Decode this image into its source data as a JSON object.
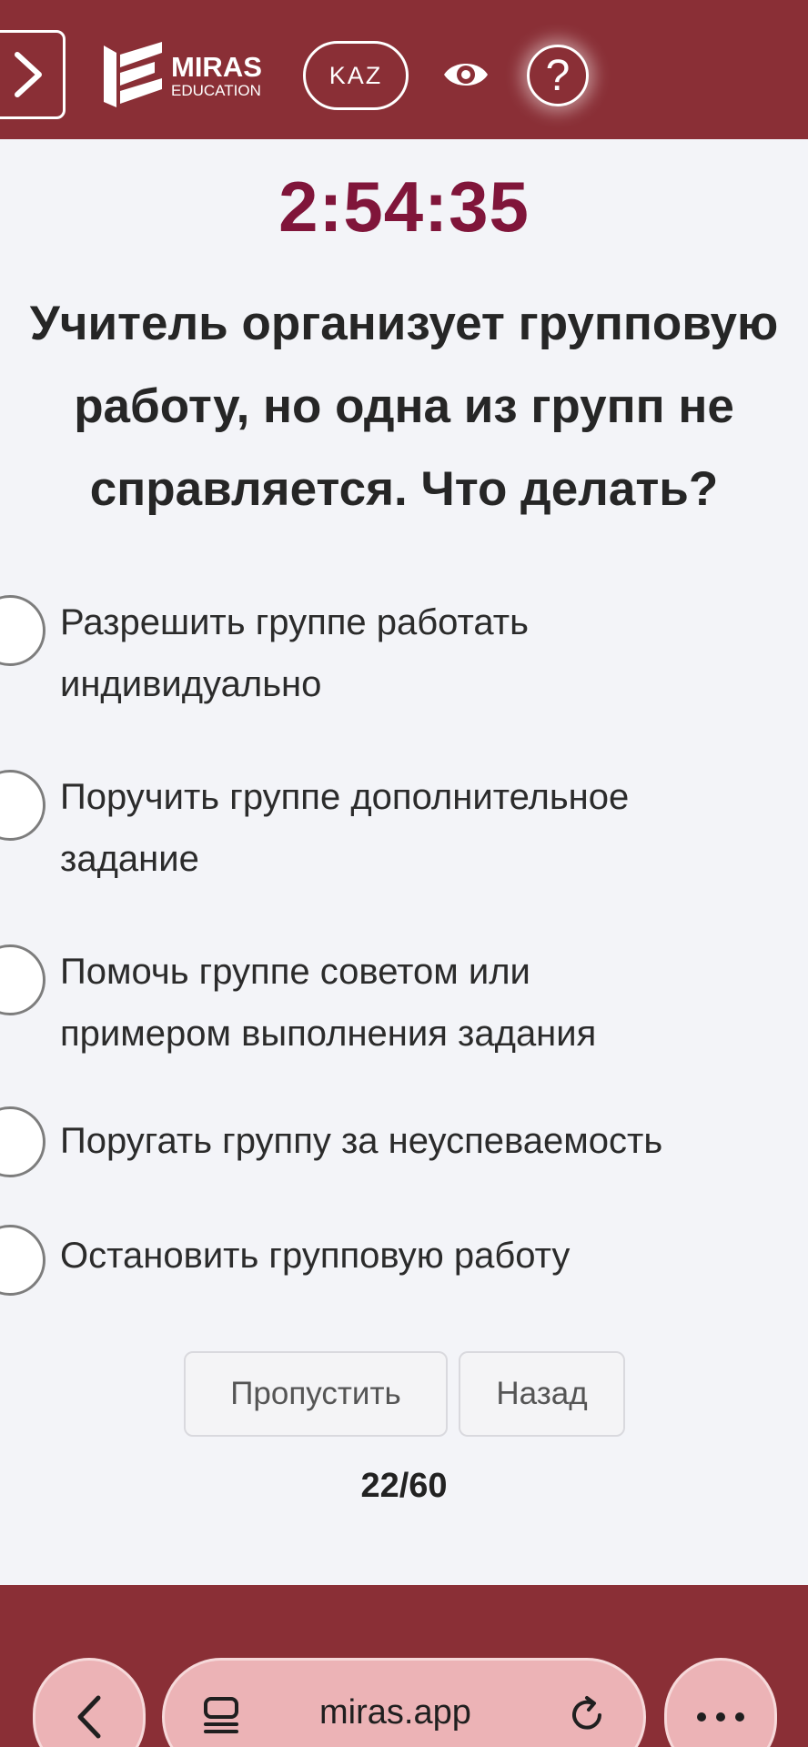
{
  "header": {
    "logo_line1": "MIRAS",
    "logo_line2": "EDUCATION",
    "language_label": "KAZ",
    "help_label": "?"
  },
  "timer": "2:54:35",
  "question": {
    "lines": [
      "Учитель организует групповую",
      "работу, но одна из групп не",
      "справляется. Что делать?"
    ]
  },
  "answers": [
    {
      "lines": [
        "Разрешить группе работать",
        "индивидуально"
      ]
    },
    {
      "lines": [
        "Поручить группе дополнительное",
        "задание"
      ]
    },
    {
      "lines": [
        "Помочь группе советом или",
        "примером выполнения задания"
      ]
    },
    {
      "lines": [
        "Поругать группу за неуспеваемость"
      ]
    },
    {
      "lines": [
        "Остановить групповую работу"
      ]
    }
  ],
  "buttons": {
    "skip_label": "Пропустить",
    "back_label": "Назад"
  },
  "progress": {
    "label": "22/60",
    "current": 22,
    "total": 60
  },
  "browser": {
    "url": "miras.app"
  },
  "colors": {
    "header_bg": "#8a2f36",
    "timer": "#80153a",
    "page_bg": "#f3f4f8",
    "browser_pill": "#ecb3b6"
  },
  "icons": [
    "chevron-right-icon",
    "miras-logo-icon",
    "eye-icon",
    "help-icon",
    "chevron-left-icon",
    "tabs-icon",
    "reload-icon",
    "more-icon"
  ]
}
